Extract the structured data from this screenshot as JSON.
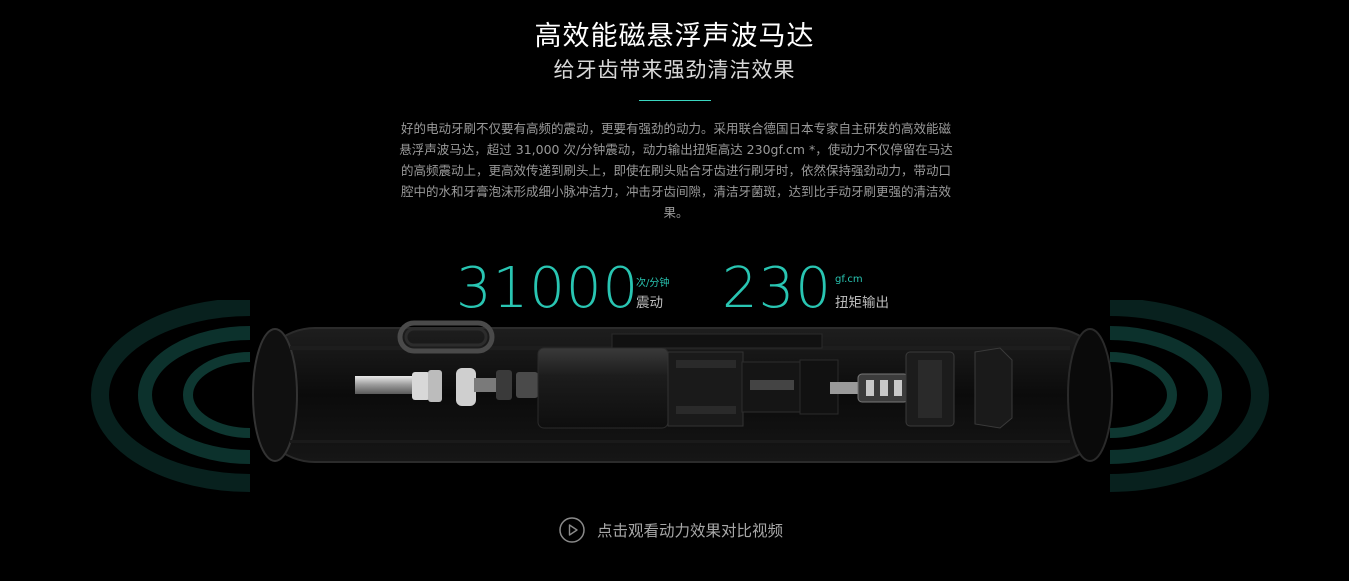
{
  "section": {
    "title": "高效能磁悬浮声波马达",
    "subtitle": "给牙齿带来强劲清洁效果",
    "description": "好的电动牙刷不仅要有高频的震动，更要有强劲的动力。采用联合德国日本专家自主研发的高效能磁悬浮声波马达，超过 31,000 次/分钟震动，动力输出扭矩高达 230gf.cm *，使动力不仅停留在马达的高频震动上，更高效传递到刷头上，即使在刷头贴合牙齿进行刷牙时，依然保持强劲动力，带动口腔中的水和牙膏泡沫形成细小脉冲洁力，冲击牙齿间隙，清洁牙菌斑，达到比手动牙刷更强的清洁效果。"
  },
  "stats": [
    {
      "value": "31000",
      "unit": "次/分钟",
      "label": "震动"
    },
    {
      "value": "230",
      "unit": "gf.cm",
      "label": "扭矩输出"
    }
  ],
  "cta": {
    "label": "点击观看动力效果对比视频",
    "icon": "play-circle-icon"
  },
  "colors": {
    "accent": "#29c5b2",
    "background": "#000000",
    "text_primary": "#ffffff",
    "text_secondary": "#9a9a9a"
  }
}
